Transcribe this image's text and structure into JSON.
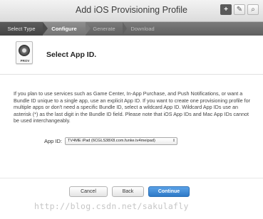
{
  "window": {
    "title": "Add iOS Provisioning Profile",
    "toolbar": {
      "add_icon": "+",
      "edit_icon": "✎",
      "search_icon": "⌕"
    }
  },
  "steps": [
    {
      "label": "Select Type",
      "state": "done"
    },
    {
      "label": "Configure",
      "state": "active"
    },
    {
      "label": "Generate",
      "state": "pending"
    },
    {
      "label": "Download",
      "state": "pending"
    }
  ],
  "header": {
    "icon_label": "PROV",
    "title": "Select App ID."
  },
  "description": "If you plan to use services such as Game Center, In-App Purchase, and Push Notifications, or want a Bundle ID unique to a single app, use an explicit App ID. If you want to create one provisioning profile for multiple apps or don't need a specific Bundle ID, select a wildcard App ID. Wildcard App IDs use an asterisk (*) as the last digit in the Bundle ID field. Please note that iOS App IDs and Mac App IDs cannot be used interchangeably.",
  "form": {
    "app_id_label": "App ID:",
    "app_id_value": "TV4ME iPad (6CGLS38X8.com.funke.tv4meipad)",
    "select_arrows": "⇕"
  },
  "buttons": {
    "cancel": "Cancel",
    "back": "Back",
    "continue": "Continue"
  },
  "watermark": "http://blog.csdn.net/sakulafly",
  "colors": {
    "accent": "#2d79c6",
    "step_bar": "#666666"
  }
}
